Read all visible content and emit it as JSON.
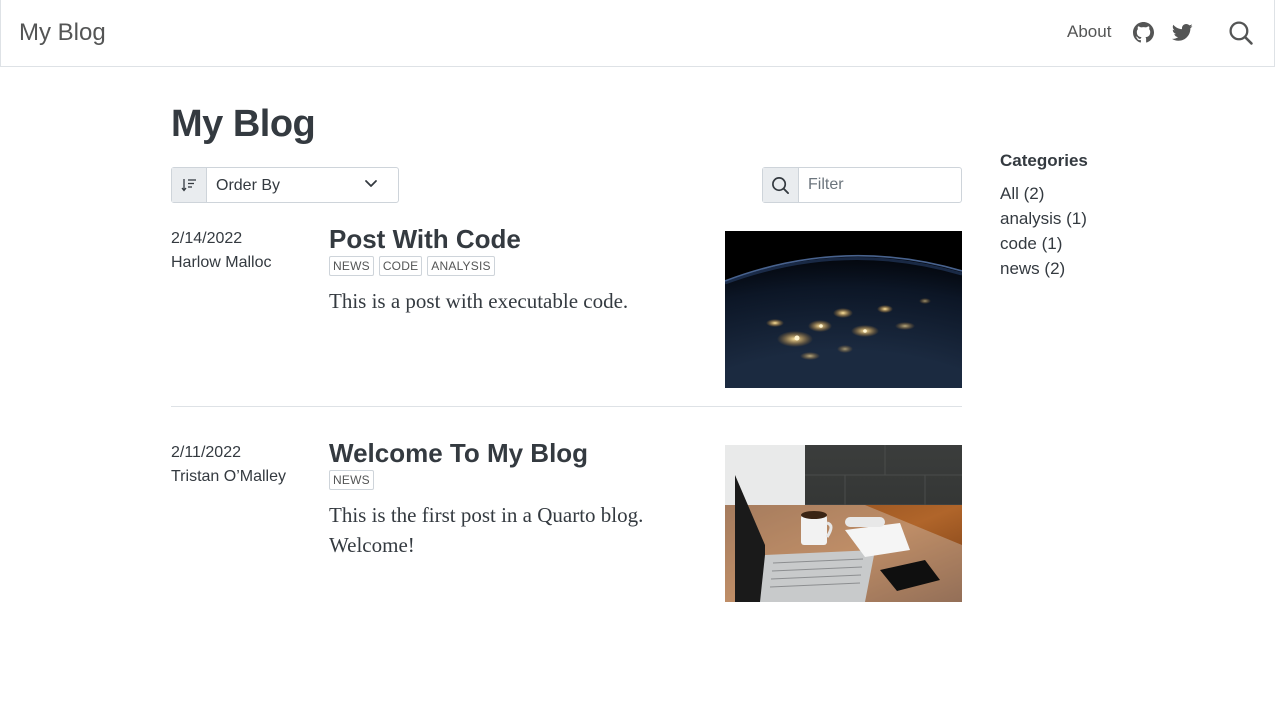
{
  "navbar": {
    "brand": "My Blog",
    "about_label": "About",
    "icons": [
      "github-icon",
      "twitter-icon",
      "search-icon"
    ]
  },
  "main": {
    "title": "My Blog",
    "order_by_label": "Order By",
    "filter_placeholder": "Filter"
  },
  "posts": [
    {
      "date": "2/14/2022",
      "author": "Harlow Malloc",
      "title": "Post With Code",
      "tags": [
        "NEWS",
        "CODE",
        "ANALYSIS"
      ],
      "description": "This is a post with executable code.",
      "thumbnail": "earth-at-night-image"
    },
    {
      "date": "2/11/2022",
      "author": "Tristan O’Malley",
      "title": "Welcome To My Blog",
      "tags": [
        "NEWS"
      ],
      "description": "This is the first post in a Quarto blog. Welcome!",
      "thumbnail": "laptop-desk-image"
    }
  ],
  "sidebar": {
    "categories_title": "Categories",
    "categories": [
      "All (2)",
      "analysis (1)",
      "code (1)",
      "news (2)"
    ]
  },
  "colors": {
    "text": "#343a40",
    "muted": "#545555",
    "border": "#dee2e6",
    "input_addon": "#e9ecef"
  }
}
